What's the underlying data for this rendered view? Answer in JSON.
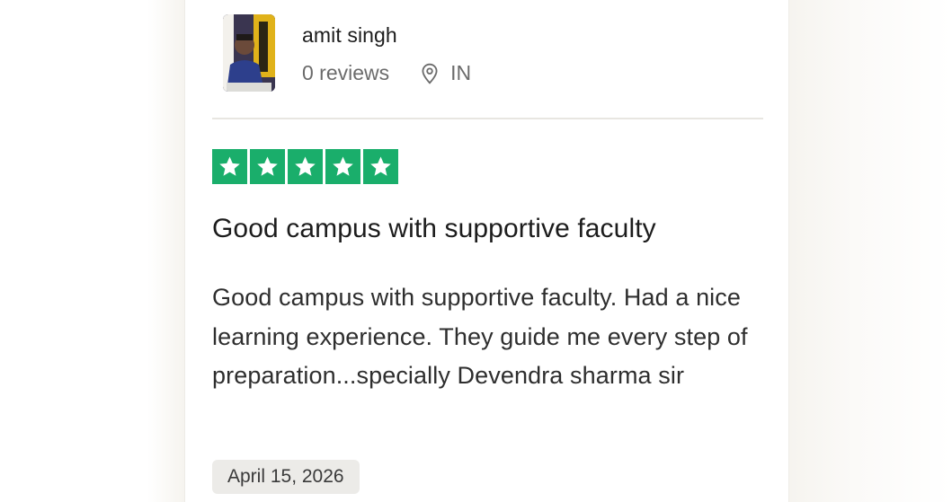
{
  "reviewer": {
    "name": "amit singh",
    "review_count": "0 reviews",
    "country": "IN",
    "avatar_icon": "avatar-photo",
    "location_icon": "map-pin-icon"
  },
  "review": {
    "rating": 5,
    "rating_max": 5,
    "star_color": "#1aae6b",
    "title": "Good campus with supportive faculty",
    "body": "Good campus with supportive faculty. Had a nice learning experience. They guide me every step of preparation...specially Devendra sharma sir",
    "date": "April 15, 2026"
  }
}
